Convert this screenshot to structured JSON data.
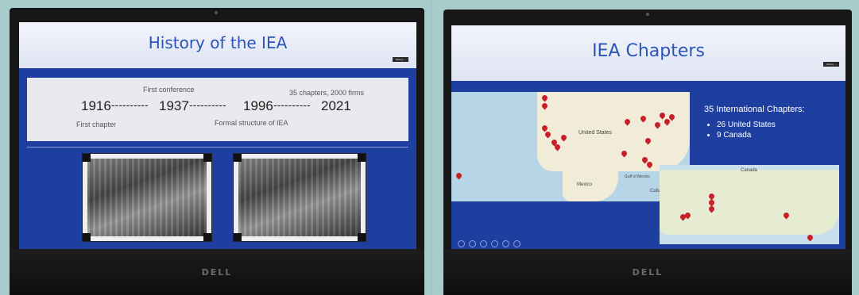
{
  "left_slide": {
    "title": "History of the IEA",
    "header_note": "Talking: ...",
    "timeline": {
      "y1916": "1916",
      "y1937": "1937",
      "y1996": "1996",
      "y2021": "2021",
      "dash": "----------",
      "first_conference": "First conference",
      "first_chapter": "First chapter",
      "formal_structure": "Formal structure of IEA",
      "chapters_firms": "35 chapters, 2000 firms"
    }
  },
  "right_slide": {
    "title": "IEA Chapters",
    "header_note": "Talking: ...",
    "info_title": "35 International Chapters:",
    "bullets": [
      "26 United States",
      "9 Canada"
    ],
    "map_labels": {
      "us": "United States",
      "mexico": "Mexico",
      "gulf": "Gulf of Mexico",
      "cuba": "Cuba",
      "canada": "Canada"
    }
  },
  "laptop_brand": "DELL",
  "colors": {
    "slide_blue": "#1f3fa0",
    "title_blue": "#2a55b8",
    "pin_red": "#c8202a",
    "wall": "#a8cccb"
  }
}
